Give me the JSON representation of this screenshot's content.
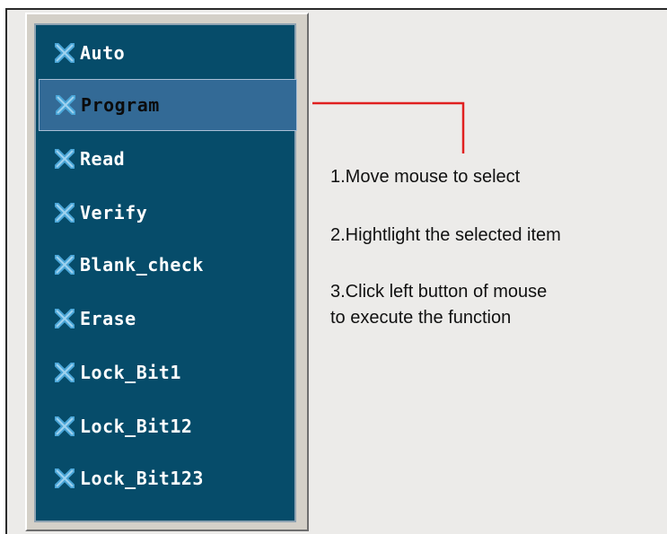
{
  "menu": {
    "items": [
      {
        "label": "Auto",
        "selected": false
      },
      {
        "label": "Program",
        "selected": true
      },
      {
        "label": "Read",
        "selected": false
      },
      {
        "label": "Verify",
        "selected": false
      },
      {
        "label": "Blank_check",
        "selected": false
      },
      {
        "label": "Erase",
        "selected": false
      },
      {
        "label": "Lock_Bit1",
        "selected": false
      },
      {
        "label": "Lock_Bit12",
        "selected": false
      },
      {
        "label": "Lock_Bit123",
        "selected": false
      }
    ],
    "item_icon": "x-icon"
  },
  "instructions": {
    "step1": "1.Move mouse to select",
    "step2": "2.Hightlight the selected item",
    "step3_line1": "3.Click left button of mouse",
    "step3_line2": "to execute the function"
  },
  "colors": {
    "menu_bg": "#064c6a",
    "selected_bg": "#336a96",
    "connector": "#e02020"
  }
}
